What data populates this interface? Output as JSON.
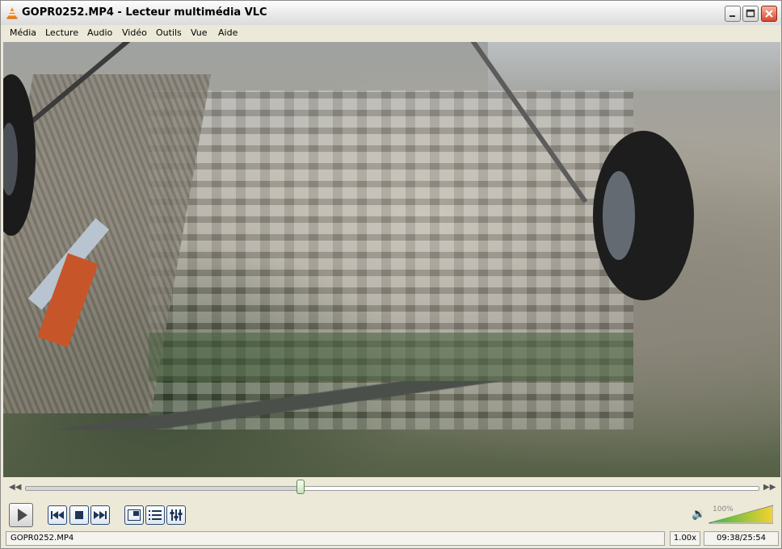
{
  "window": {
    "title": "GOPR0252.MP4 - Lecteur multimédia VLC",
    "app_icon": "vlc-cone-icon"
  },
  "menu": {
    "items": [
      "Média",
      "Lecture",
      "Audio",
      "Vidéo",
      "Outils",
      "Vue",
      "Aide"
    ]
  },
  "seek": {
    "position": 0.375
  },
  "controls": {
    "play_icon": "play-icon",
    "prev_icon": "previous-icon",
    "stop_icon": "stop-icon",
    "next_icon": "next-icon",
    "fullscreen_icon": "fullscreen-icon",
    "playlist_icon": "playlist-icon",
    "extended_icon": "extended-settings-icon"
  },
  "volume": {
    "label": "100%",
    "level": 1.0,
    "icon": "speaker-icon",
    "colors": [
      "#39b54a",
      "#f2d22e"
    ]
  },
  "status": {
    "filename": "GOPR0252.MP4",
    "speed": "1.00x",
    "time": "09:38/25:54"
  }
}
